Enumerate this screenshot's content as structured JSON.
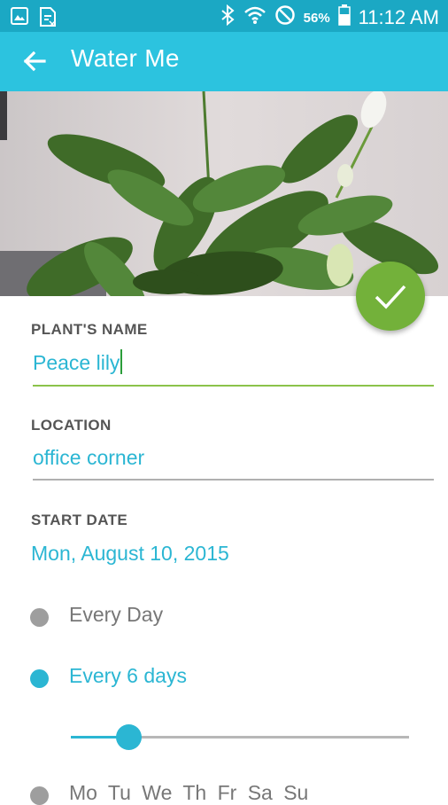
{
  "status_bar": {
    "left_icons": [
      "image-icon",
      "document-icon"
    ],
    "right_icons": [
      "bluetooth-icon",
      "wifi-icon",
      "do-not-disturb-icon"
    ],
    "battery_percent": "56%",
    "time": "11:12 AM"
  },
  "app_bar": {
    "back_icon": "arrow-back-icon",
    "title": "Water Me"
  },
  "fab": {
    "icon": "check-icon",
    "color": "#73b13a"
  },
  "form": {
    "name": {
      "label": "PLANT'S NAME",
      "value": "Peace lily"
    },
    "location": {
      "label": "LOCATION",
      "value": "office corner"
    },
    "start_date": {
      "label": "START DATE",
      "value": "Mon, August 10, 2015"
    }
  },
  "frequency": {
    "options": [
      {
        "label": "Every Day",
        "selected": false
      },
      {
        "label": "Every 6 days",
        "selected": true
      },
      {
        "label": "Mo Tu We Th Fr Sa Su",
        "selected": false
      }
    ],
    "slider_fraction": 0.17
  },
  "colors": {
    "status_bar": "#1ba8c4",
    "app_bar": "#2cc3df",
    "accent": "#2bb6d3",
    "fab": "#73b13a",
    "field_active_underline": "#8bc34a",
    "field_underline": "#b0b0b0"
  }
}
